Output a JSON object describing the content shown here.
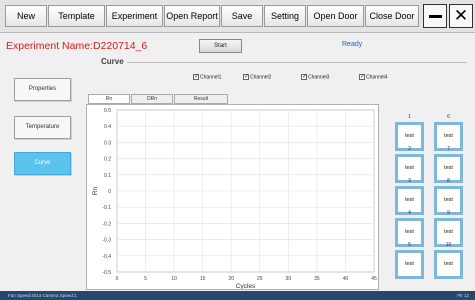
{
  "toolbar": {
    "new": "New",
    "template": "Template",
    "experiment": "Experiment",
    "open_report": "Open Report",
    "save": "Save",
    "setting": "Setting",
    "open_door": "Open Door",
    "close_door": "Close Door",
    "minimize_icon": "minimize-icon",
    "close_icon": "close-icon",
    "close_glyph": "✕"
  },
  "header": {
    "experiment_name": "Experiment Name:D220714_6",
    "start_label": "Start",
    "status": "Ready"
  },
  "section": {
    "title": "Curve"
  },
  "sidebar": {
    "items": [
      {
        "label": "Properties",
        "active": false
      },
      {
        "label": "Temperature",
        "active": false
      },
      {
        "label": "Curve",
        "active": true
      }
    ]
  },
  "channels": [
    {
      "label": "Channel1",
      "checked": true,
      "mark": "✓"
    },
    {
      "label": "Channel2",
      "checked": true,
      "mark": "✓"
    },
    {
      "label": "Channel3",
      "checked": true,
      "mark": "✓"
    },
    {
      "label": "Channel4",
      "checked": true,
      "mark": "✓"
    }
  ],
  "tabs": [
    "Rn",
    "DRn",
    "Result"
  ],
  "chart_data": {
    "type": "line",
    "title": "",
    "xlabel": "Cycles",
    "ylabel": "Rn",
    "xlim": [
      0,
      45
    ],
    "ylim": [
      -0.5,
      0.5
    ],
    "xticks": [
      0,
      5,
      10,
      15,
      20,
      25,
      30,
      35,
      40,
      45
    ],
    "yticks": [
      0.5,
      0.4,
      0.3,
      0.2,
      0.1,
      0,
      -0.1,
      -0.2,
      -0.3,
      -0.4,
      -0.5
    ],
    "grid": true,
    "series": []
  },
  "wells": [
    {
      "num": "1",
      "label": "test"
    },
    {
      "num": "6",
      "label": "test"
    },
    {
      "num": "2",
      "label": "test"
    },
    {
      "num": "7",
      "label": "test"
    },
    {
      "num": "3",
      "label": "test"
    },
    {
      "num": "8",
      "label": "test"
    },
    {
      "num": "4",
      "label": "test"
    },
    {
      "num": "9",
      "label": "test"
    },
    {
      "num": "5",
      "label": "test"
    },
    {
      "num": "10",
      "label": "test"
    }
  ],
  "statusbar": {
    "left": "Fan Speed:4014 Camera Speed:1",
    "right": "Plr 12"
  },
  "colors": {
    "accent": "#5cc3f0",
    "experiment_name": "#d91a1a",
    "status": "#1a5fc4",
    "well_border": "#7fb6dc",
    "statusbar": "#25486e"
  }
}
